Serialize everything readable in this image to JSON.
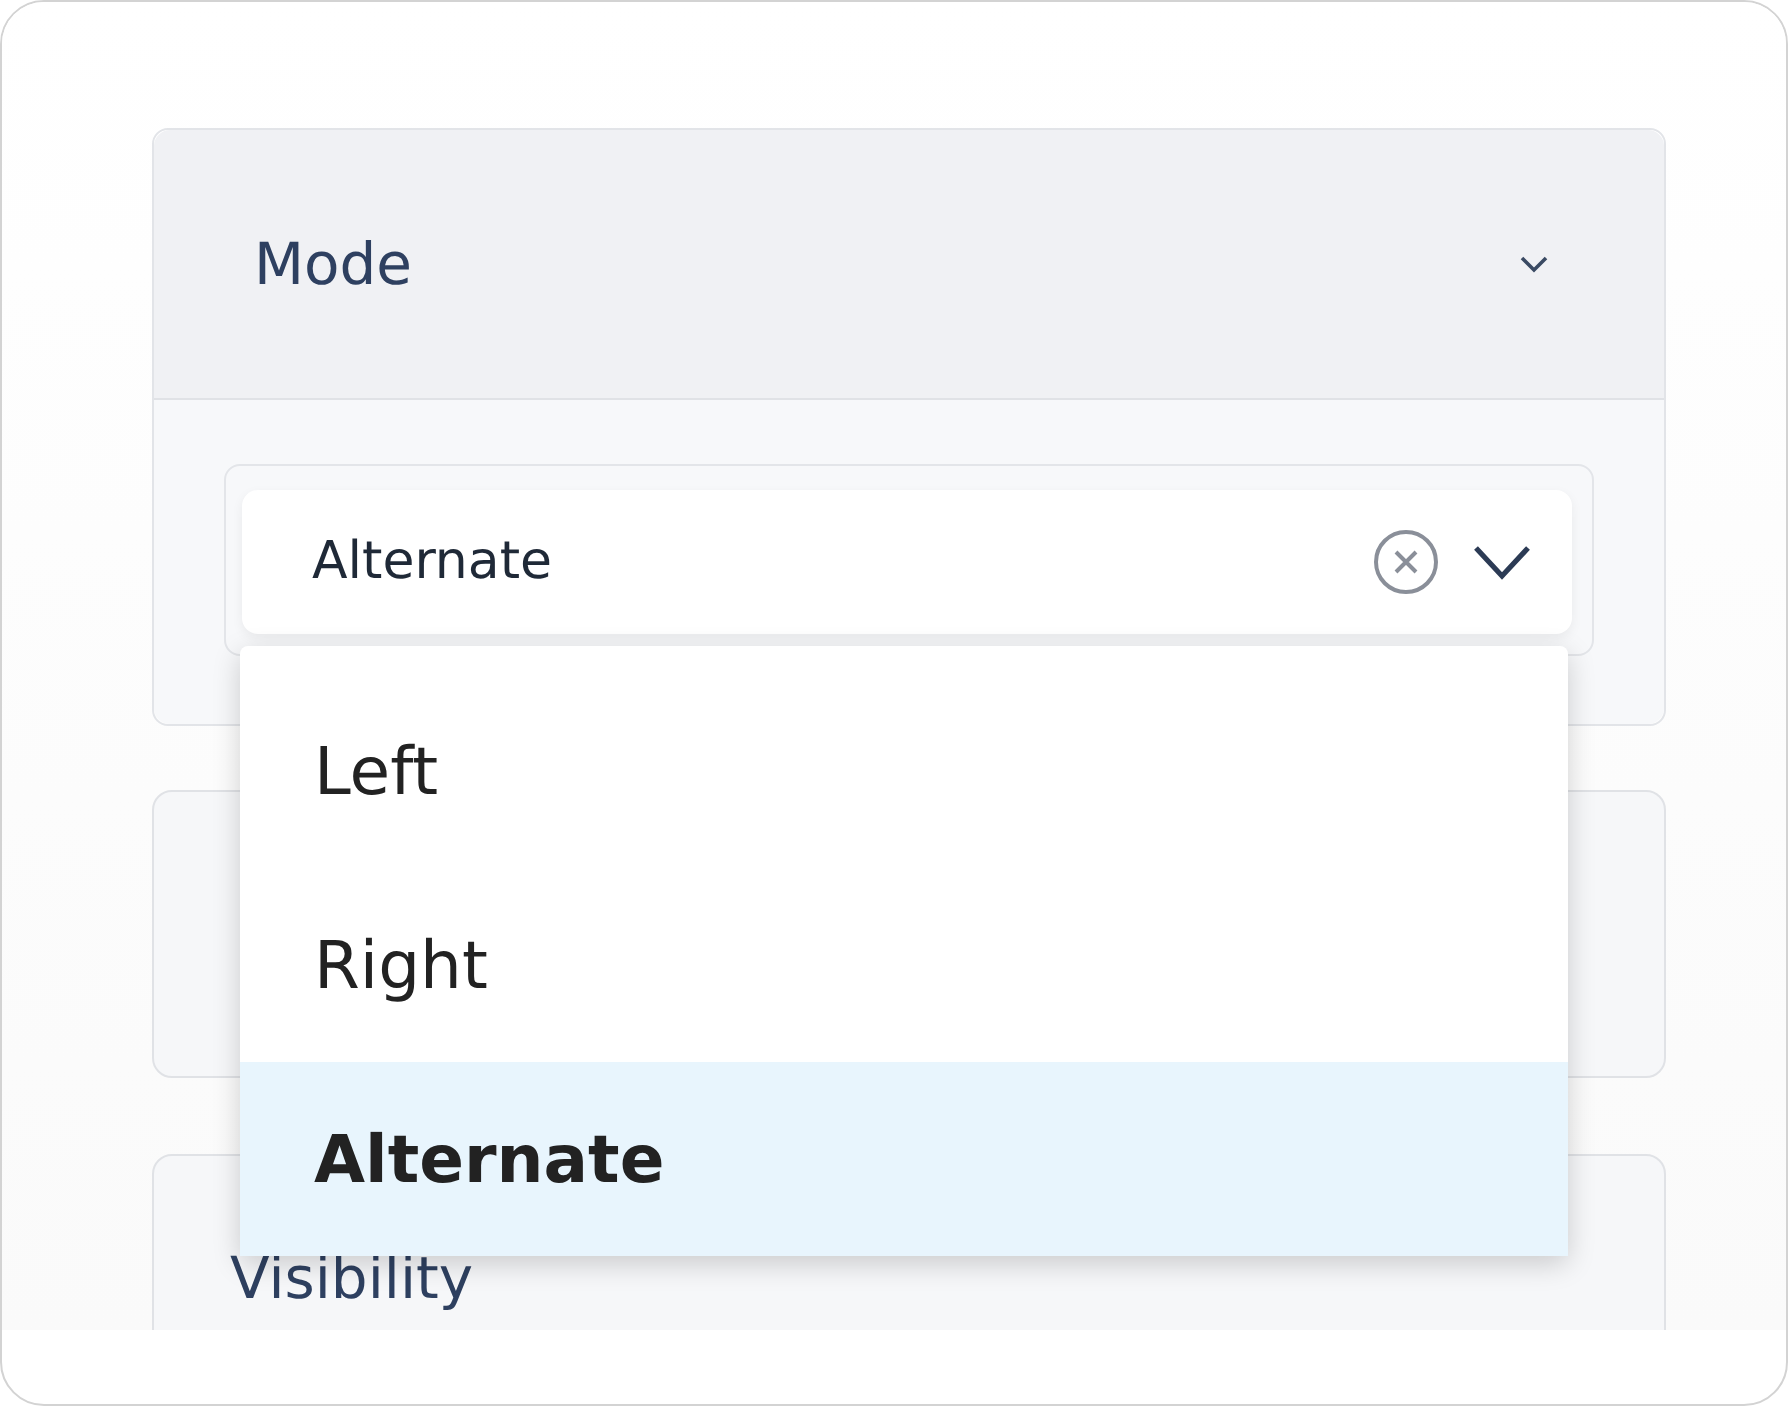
{
  "mode_panel": {
    "title": "Mode",
    "expanded": true,
    "select": {
      "value": "Alternate",
      "clearable": true
    },
    "options": [
      {
        "label": "Left",
        "selected": false
      },
      {
        "label": "Right",
        "selected": false
      },
      {
        "label": "Alternate",
        "selected": true
      }
    ]
  },
  "visibility_panel": {
    "title": "Visibility"
  }
}
